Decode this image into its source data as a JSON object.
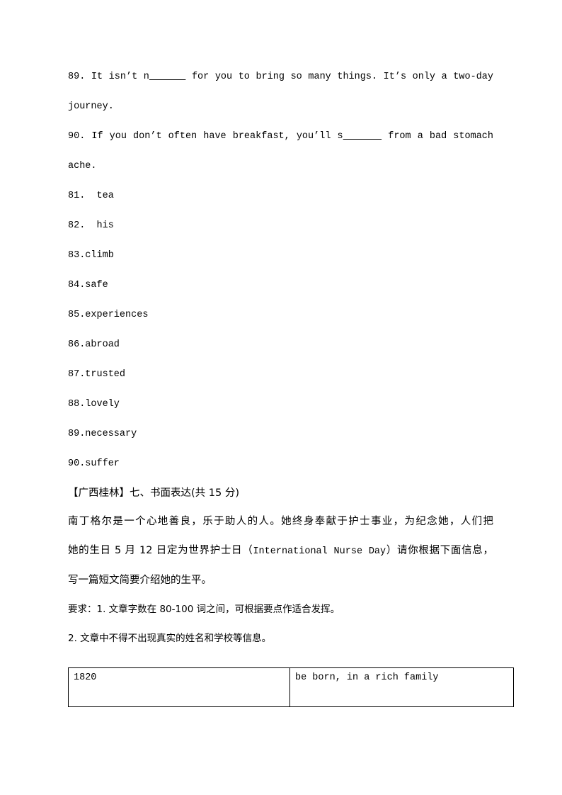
{
  "document": {
    "type": "exam-answer-sheet",
    "language": "zh-CN + en",
    "page_background": "#ffffff",
    "text_color": "#000000"
  },
  "questions": [
    {
      "number": "89.",
      "line1": "89. It isn’t n______ for you to bring so many things. It’s only a two-day",
      "line2": "journey."
    },
    {
      "number": "90.",
      "line1": "90. If you don’t often have breakfast, you’ll s______ from a bad stomach",
      "line2": "ache."
    }
  ],
  "answer_key": [
    {
      "num": "81.",
      "sep": "  ",
      "word": "tea",
      "text": "81.  tea"
    },
    {
      "num": "82.",
      "sep": "  ",
      "word": "his",
      "text": "82.  his"
    },
    {
      "num": "83.",
      "sep": "",
      "word": "climb",
      "text": "83.climb"
    },
    {
      "num": "84.",
      "sep": "",
      "word": "safe",
      "text": "84.safe"
    },
    {
      "num": "85.",
      "sep": "",
      "word": "experiences",
      "text": "85.experiences"
    },
    {
      "num": "86.",
      "sep": "",
      "word": "abroad",
      "text": "86.abroad"
    },
    {
      "num": "87.",
      "sep": "",
      "word": "trusted",
      "text": "87.trusted"
    },
    {
      "num": "88.",
      "sep": "",
      "word": "lovely",
      "text": "88.lovely"
    },
    {
      "num": "89.",
      "sep": "",
      "word": "necessary",
      "text": "89.necessary"
    },
    {
      "num": "90.",
      "sep": "",
      "word": "suffer",
      "text": "90.suffer"
    }
  ],
  "writing_section": {
    "heading": "【广西桂林】七、书面表达(共 15 分)",
    "prompt_line1": "南丁格尔是一个心地善良，乐于助人的人。她终身奉献于护士事业，为纪念她，人们把",
    "prompt_line2_part1": "她的生日 5 月 12 日定为世界护士日（",
    "prompt_line2_en": "International Nurse Day",
    "prompt_line2_part2": "）请你根据下面信息，",
    "prompt_line3": "写一篇短文简要介绍她的生平。",
    "requirements": [
      "要求：1. 文章字数在 80-100 词之间，可根据要点作适合发挥。",
      "2. 文章中不得不出现真实的姓名和学校等信息。"
    ]
  },
  "info_table": {
    "rows": [
      {
        "year": "1820",
        "event": "be born, in a rich family"
      }
    ]
  }
}
